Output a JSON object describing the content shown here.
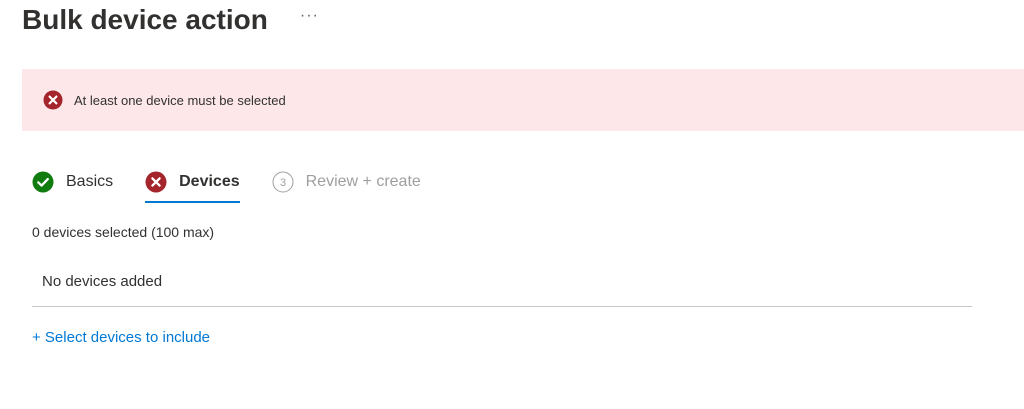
{
  "header": {
    "title": "Bulk device action",
    "more_label": "···"
  },
  "banner": {
    "icon": "error-icon",
    "message": "At least one device must be selected",
    "color": "#a4262c",
    "background": "#fde7e9"
  },
  "steps": [
    {
      "label": "Basics",
      "status": "complete",
      "icon": "checkmark-circle-icon"
    },
    {
      "label": "Devices",
      "status": "error",
      "icon": "error-icon",
      "active": true
    },
    {
      "label": "Review + create",
      "number": "3",
      "status": "pending",
      "icon": "step-number-icon"
    }
  ],
  "devices": {
    "selection_count": "0 devices selected (100 max)",
    "empty_text": "No devices added",
    "add_link": "+ Select devices to include"
  },
  "colors": {
    "accent": "#0078d4",
    "success": "#107c10",
    "error": "#a4262c",
    "disabled": "#a19f9d"
  }
}
